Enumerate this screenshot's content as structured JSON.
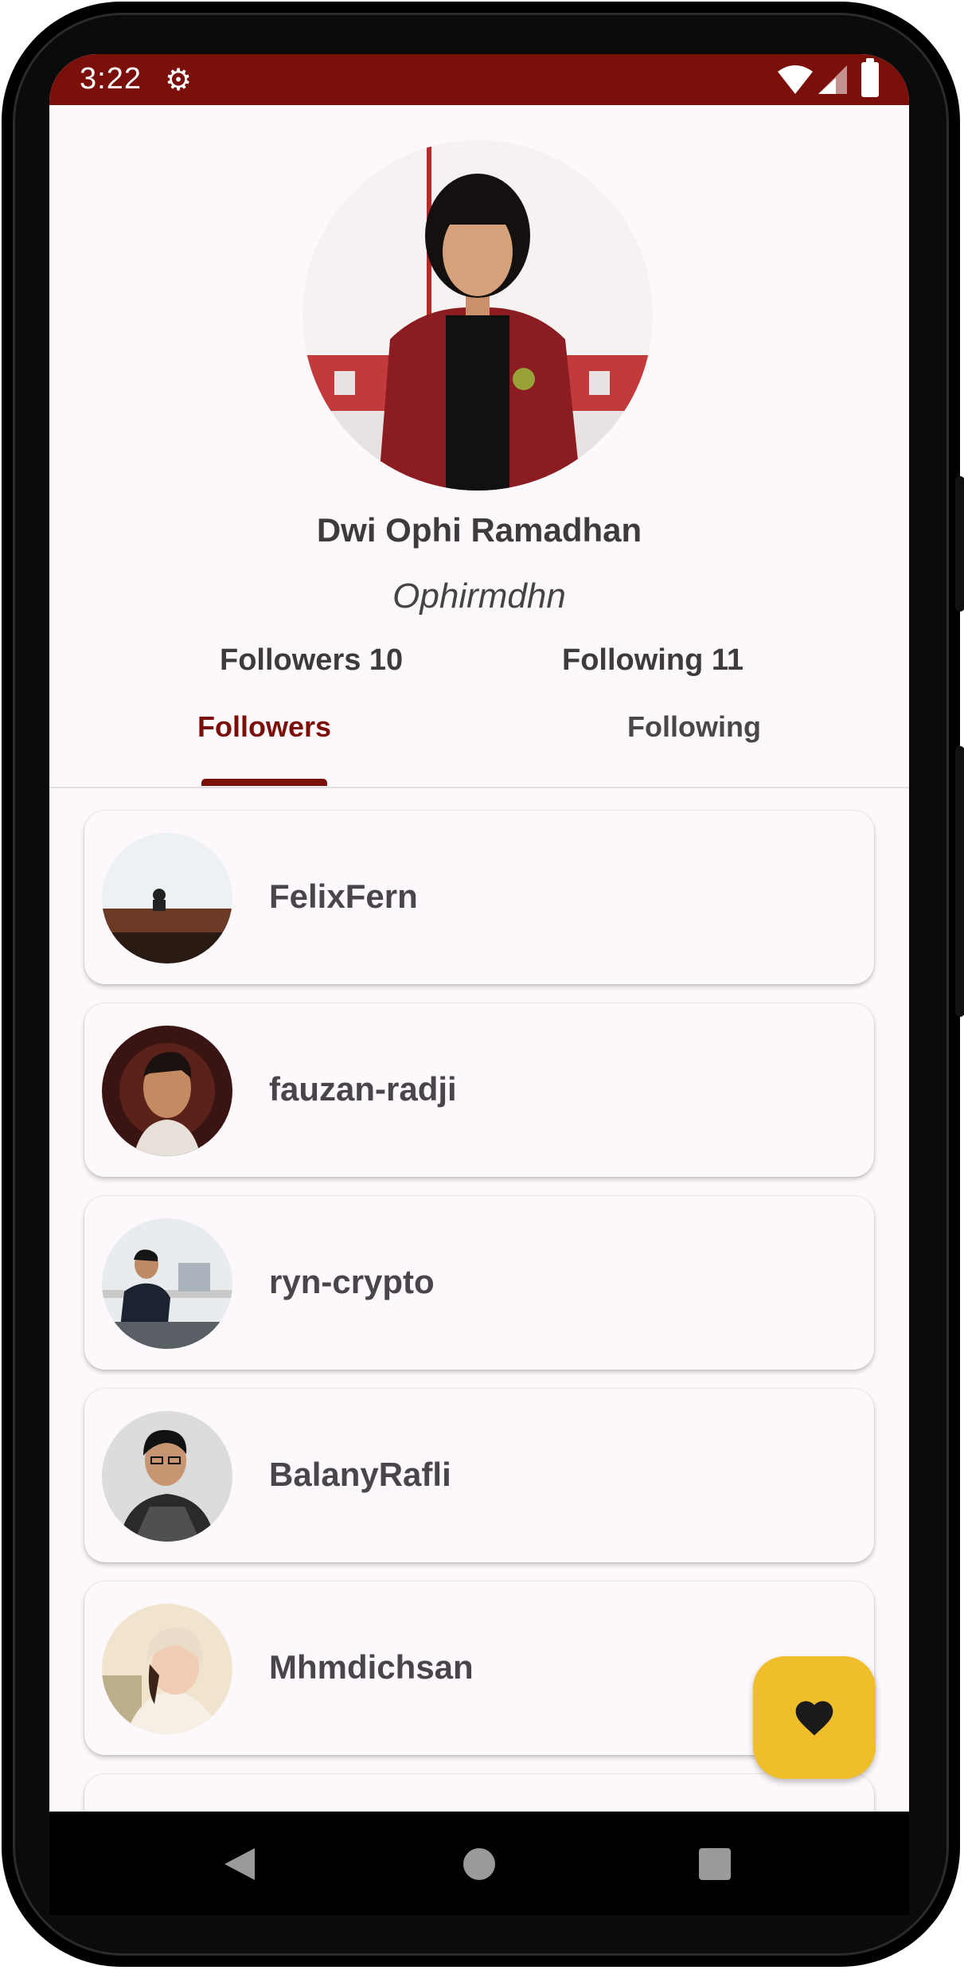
{
  "status_bar": {
    "time": "3:22",
    "icons": [
      "gear-icon",
      "wifi-icon",
      "signal-icon",
      "battery-icon"
    ]
  },
  "profile": {
    "name": "Dwi Ophi Ramadhan",
    "username": "Ophirmdhn",
    "followers_label": "Followers 10",
    "following_label": "Following 11"
  },
  "tabs": [
    {
      "label": "Followers",
      "selected": true
    },
    {
      "label": "Following",
      "selected": false
    }
  ],
  "followers": [
    {
      "username": "FelixFern"
    },
    {
      "username": "fauzan-radji"
    },
    {
      "username": "ryn-crypto"
    },
    {
      "username": "BalanyRafli"
    },
    {
      "username": "Mhmdichsan"
    }
  ],
  "fab": {
    "icon": "heart-icon"
  },
  "colors": {
    "primary": "#7b0f0a",
    "fab": "#f0bd2b",
    "background": "#fdf8fb"
  }
}
